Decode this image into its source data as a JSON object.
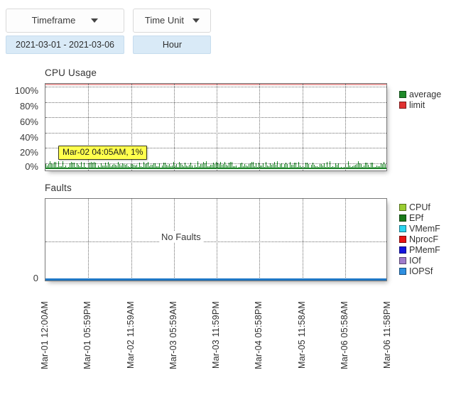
{
  "toolbar": {
    "timeframe": {
      "button_label": "Timeframe",
      "caret_icon": "chevron-down-icon",
      "selected_value": "2021-03-01 - 2021-03-06"
    },
    "time_unit": {
      "button_label": "Time Unit",
      "caret_icon": "chevron-down-icon",
      "selected_value": "Hour"
    }
  },
  "chart_data": [
    {
      "type": "line",
      "title": "CPU Usage",
      "xlabel": "",
      "ylabel": "",
      "ylim": [
        0,
        100
      ],
      "ytick_labels": [
        "100%",
        "80%",
        "60%",
        "40%",
        "20%",
        "0%"
      ],
      "ytick_values": [
        100,
        80,
        60,
        40,
        20,
        0
      ],
      "grid": true,
      "legend_position": "right",
      "x": [
        "Mar-01 12:00AM",
        "Mar-01 05:59PM",
        "Mar-02 11:59AM",
        "Mar-03 05:59AM",
        "Mar-03 11:59PM",
        "Mar-04 05:58PM",
        "Mar-05 11:58AM",
        "Mar-06 05:58AM",
        "Mar-06 11:58PM"
      ],
      "series": [
        {
          "name": "average",
          "color": "#1f8a2a",
          "approx_value": 1,
          "unit": "%"
        },
        {
          "name": "limit",
          "color": "#e03131",
          "approx_value": 100,
          "unit": "%"
        }
      ],
      "annotation": {
        "text": "Mar-02 04:05AM, 1%",
        "bg_color": "#ffff4d",
        "border_color": "#3d3d1a"
      }
    },
    {
      "type": "line",
      "title": "Faults",
      "xlabel": "",
      "ylabel": "",
      "ytick_labels": [
        "0"
      ],
      "ytick_values": [
        0
      ],
      "grid": true,
      "legend_position": "right",
      "empty_message": "No Faults",
      "x": [
        "Mar-01 12:00AM",
        "Mar-01 05:59PM",
        "Mar-02 11:59AM",
        "Mar-03 05:59AM",
        "Mar-03 11:59PM",
        "Mar-04 05:58PM",
        "Mar-05 11:58AM",
        "Mar-06 05:58AM",
        "Mar-06 11:58PM"
      ],
      "series": [
        {
          "name": "CPUf",
          "color": "#9acd32",
          "values": [
            0,
            0,
            0,
            0,
            0,
            0,
            0,
            0,
            0
          ]
        },
        {
          "name": "EPf",
          "color": "#1a7a1a",
          "values": [
            0,
            0,
            0,
            0,
            0,
            0,
            0,
            0,
            0
          ]
        },
        {
          "name": "VMemF",
          "color": "#2ad4f0",
          "values": [
            0,
            0,
            0,
            0,
            0,
            0,
            0,
            0,
            0
          ]
        },
        {
          "name": "NprocF",
          "color": "#e81313",
          "values": [
            0,
            0,
            0,
            0,
            0,
            0,
            0,
            0,
            0
          ]
        },
        {
          "name": "PMemF",
          "color": "#1414e0",
          "values": [
            0,
            0,
            0,
            0,
            0,
            0,
            0,
            0,
            0
          ]
        },
        {
          "name": "IOf",
          "color": "#a07ccc",
          "values": [
            0,
            0,
            0,
            0,
            0,
            0,
            0,
            0,
            0
          ]
        },
        {
          "name": "IOPSf",
          "color": "#2e8fe0",
          "values": [
            0,
            0,
            0,
            0,
            0,
            0,
            0,
            0,
            0
          ]
        }
      ],
      "baseline_color": "#1f77c4"
    }
  ]
}
